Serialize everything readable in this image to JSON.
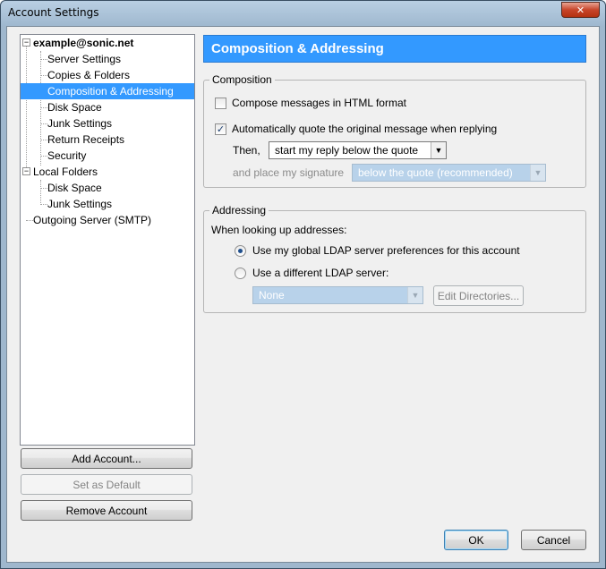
{
  "window": {
    "title": "Account Settings",
    "close_glyph": "✕"
  },
  "tree": {
    "items": [
      {
        "label": "example@sonic.net",
        "bold": true,
        "expander": "−"
      },
      {
        "label": "Server Settings"
      },
      {
        "label": "Copies & Folders"
      },
      {
        "label": "Composition & Addressing",
        "selected": true
      },
      {
        "label": "Disk Space"
      },
      {
        "label": "Junk Settings"
      },
      {
        "label": "Return Receipts"
      },
      {
        "label": "Security"
      },
      {
        "label": "Local Folders",
        "expander": "−"
      },
      {
        "label": "Disk Space"
      },
      {
        "label": "Junk Settings"
      },
      {
        "label": "Outgoing Server (SMTP)"
      }
    ]
  },
  "buttons": {
    "add_account": "Add Account...",
    "set_default": "Set as Default",
    "remove_account": "Remove Account",
    "ok": "OK",
    "cancel": "Cancel",
    "edit_directories": "Edit Directories..."
  },
  "panel": {
    "header": "Composition & Addressing",
    "composition": {
      "legend": "Composition",
      "html_format": {
        "label": "Compose messages in HTML format",
        "checked": false
      },
      "auto_quote": {
        "label": "Automatically quote the original message when replying",
        "checked": true
      },
      "then_label": "Then,",
      "then_value": "start my reply below the quote",
      "signature_label": "and place my signature",
      "signature_value": "below the quote (recommended)"
    },
    "addressing": {
      "legend": "Addressing",
      "lookup_label": "When looking up addresses:",
      "global_ldap": {
        "label": "Use my global LDAP server preferences for this account",
        "selected": true
      },
      "different_ldap": {
        "label": "Use a different LDAP server:",
        "selected": false
      },
      "ldap_value": "None"
    }
  },
  "glyphs": {
    "check": "✓",
    "dropdown": "▼"
  }
}
